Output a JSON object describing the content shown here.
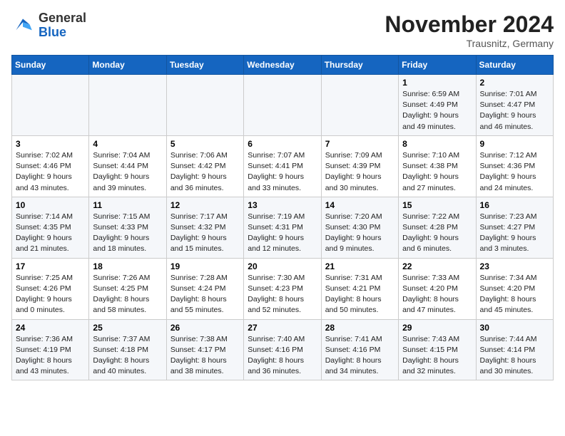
{
  "logo": {
    "general": "General",
    "blue": "Blue"
  },
  "title": "November 2024",
  "location": "Trausnitz, Germany",
  "days_of_week": [
    "Sunday",
    "Monday",
    "Tuesday",
    "Wednesday",
    "Thursday",
    "Friday",
    "Saturday"
  ],
  "weeks": [
    [
      {
        "day": "",
        "info": ""
      },
      {
        "day": "",
        "info": ""
      },
      {
        "day": "",
        "info": ""
      },
      {
        "day": "",
        "info": ""
      },
      {
        "day": "",
        "info": ""
      },
      {
        "day": "1",
        "info": "Sunrise: 6:59 AM\nSunset: 4:49 PM\nDaylight: 9 hours and 49 minutes."
      },
      {
        "day": "2",
        "info": "Sunrise: 7:01 AM\nSunset: 4:47 PM\nDaylight: 9 hours and 46 minutes."
      }
    ],
    [
      {
        "day": "3",
        "info": "Sunrise: 7:02 AM\nSunset: 4:46 PM\nDaylight: 9 hours and 43 minutes."
      },
      {
        "day": "4",
        "info": "Sunrise: 7:04 AM\nSunset: 4:44 PM\nDaylight: 9 hours and 39 minutes."
      },
      {
        "day": "5",
        "info": "Sunrise: 7:06 AM\nSunset: 4:42 PM\nDaylight: 9 hours and 36 minutes."
      },
      {
        "day": "6",
        "info": "Sunrise: 7:07 AM\nSunset: 4:41 PM\nDaylight: 9 hours and 33 minutes."
      },
      {
        "day": "7",
        "info": "Sunrise: 7:09 AM\nSunset: 4:39 PM\nDaylight: 9 hours and 30 minutes."
      },
      {
        "day": "8",
        "info": "Sunrise: 7:10 AM\nSunset: 4:38 PM\nDaylight: 9 hours and 27 minutes."
      },
      {
        "day": "9",
        "info": "Sunrise: 7:12 AM\nSunset: 4:36 PM\nDaylight: 9 hours and 24 minutes."
      }
    ],
    [
      {
        "day": "10",
        "info": "Sunrise: 7:14 AM\nSunset: 4:35 PM\nDaylight: 9 hours and 21 minutes."
      },
      {
        "day": "11",
        "info": "Sunrise: 7:15 AM\nSunset: 4:33 PM\nDaylight: 9 hours and 18 minutes."
      },
      {
        "day": "12",
        "info": "Sunrise: 7:17 AM\nSunset: 4:32 PM\nDaylight: 9 hours and 15 minutes."
      },
      {
        "day": "13",
        "info": "Sunrise: 7:19 AM\nSunset: 4:31 PM\nDaylight: 9 hours and 12 minutes."
      },
      {
        "day": "14",
        "info": "Sunrise: 7:20 AM\nSunset: 4:30 PM\nDaylight: 9 hours and 9 minutes."
      },
      {
        "day": "15",
        "info": "Sunrise: 7:22 AM\nSunset: 4:28 PM\nDaylight: 9 hours and 6 minutes."
      },
      {
        "day": "16",
        "info": "Sunrise: 7:23 AM\nSunset: 4:27 PM\nDaylight: 9 hours and 3 minutes."
      }
    ],
    [
      {
        "day": "17",
        "info": "Sunrise: 7:25 AM\nSunset: 4:26 PM\nDaylight: 9 hours and 0 minutes."
      },
      {
        "day": "18",
        "info": "Sunrise: 7:26 AM\nSunset: 4:25 PM\nDaylight: 8 hours and 58 minutes."
      },
      {
        "day": "19",
        "info": "Sunrise: 7:28 AM\nSunset: 4:24 PM\nDaylight: 8 hours and 55 minutes."
      },
      {
        "day": "20",
        "info": "Sunrise: 7:30 AM\nSunset: 4:23 PM\nDaylight: 8 hours and 52 minutes."
      },
      {
        "day": "21",
        "info": "Sunrise: 7:31 AM\nSunset: 4:21 PM\nDaylight: 8 hours and 50 minutes."
      },
      {
        "day": "22",
        "info": "Sunrise: 7:33 AM\nSunset: 4:20 PM\nDaylight: 8 hours and 47 minutes."
      },
      {
        "day": "23",
        "info": "Sunrise: 7:34 AM\nSunset: 4:20 PM\nDaylight: 8 hours and 45 minutes."
      }
    ],
    [
      {
        "day": "24",
        "info": "Sunrise: 7:36 AM\nSunset: 4:19 PM\nDaylight: 8 hours and 43 minutes."
      },
      {
        "day": "25",
        "info": "Sunrise: 7:37 AM\nSunset: 4:18 PM\nDaylight: 8 hours and 40 minutes."
      },
      {
        "day": "26",
        "info": "Sunrise: 7:38 AM\nSunset: 4:17 PM\nDaylight: 8 hours and 38 minutes."
      },
      {
        "day": "27",
        "info": "Sunrise: 7:40 AM\nSunset: 4:16 PM\nDaylight: 8 hours and 36 minutes."
      },
      {
        "day": "28",
        "info": "Sunrise: 7:41 AM\nSunset: 4:16 PM\nDaylight: 8 hours and 34 minutes."
      },
      {
        "day": "29",
        "info": "Sunrise: 7:43 AM\nSunset: 4:15 PM\nDaylight: 8 hours and 32 minutes."
      },
      {
        "day": "30",
        "info": "Sunrise: 7:44 AM\nSunset: 4:14 PM\nDaylight: 8 hours and 30 minutes."
      }
    ]
  ]
}
